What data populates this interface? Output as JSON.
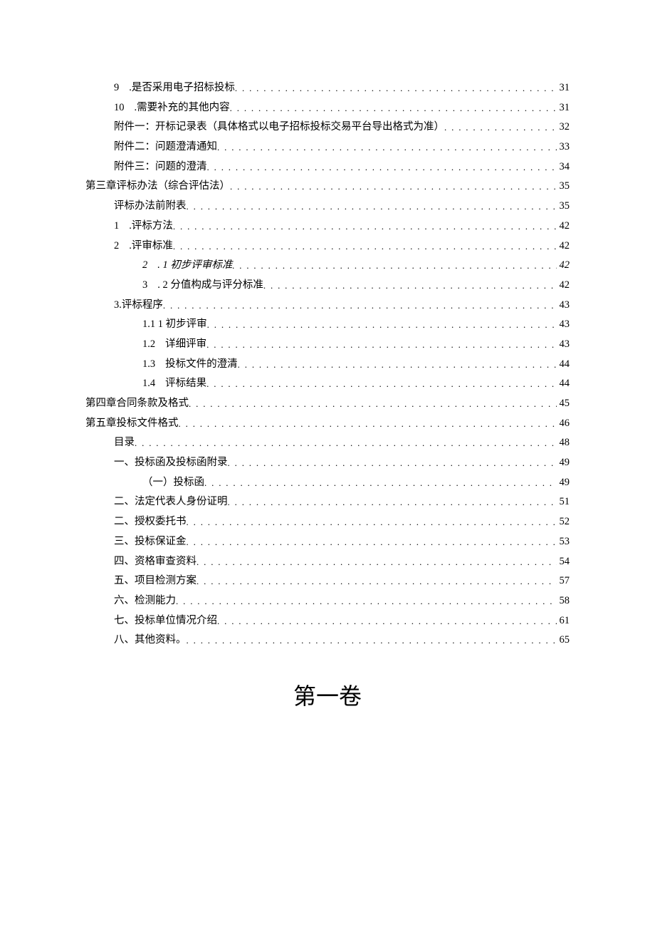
{
  "toc": [
    {
      "indent": 1,
      "num": "9",
      "sep": true,
      "label": ".是否采用电子招标投标",
      "page": "31",
      "italic": false
    },
    {
      "indent": 1,
      "num": "10",
      "sep": true,
      "label": ".需要补充的其他内容",
      "page": "31",
      "italic": false
    },
    {
      "indent": 1,
      "num": "",
      "sep": false,
      "label": "附件一：开标记录表（具体格式以电子招标投标交易平台导出格式为准）",
      "page": "32",
      "italic": false
    },
    {
      "indent": 1,
      "num": "",
      "sep": false,
      "label": "附件二：问题澄清通知",
      "page": "33",
      "italic": false
    },
    {
      "indent": 1,
      "num": "",
      "sep": false,
      "label": "附件三：问题的澄清",
      "page": "34",
      "italic": false
    },
    {
      "indent": 0,
      "num": "",
      "sep": false,
      "label": "第三章评标办法（综合评估法）",
      "page": "35",
      "italic": false
    },
    {
      "indent": 1,
      "num": "",
      "sep": false,
      "label": "评标办法前附表",
      "page": "35",
      "italic": false
    },
    {
      "indent": 1,
      "num": "1",
      "sep": true,
      "label": ".评标方法",
      "page": "42",
      "italic": false
    },
    {
      "indent": 1,
      "num": "2",
      "sep": true,
      "label": ".评审标准",
      "page": "42",
      "italic": false
    },
    {
      "indent": 2,
      "num": "2",
      "sep": true,
      "label": ". 1 初步评审标准",
      "page": "42",
      "italic": true
    },
    {
      "indent": 2,
      "num": "3",
      "sep": true,
      "label": ". 2 分值构成与评分标准",
      "page": "42",
      "italic": false
    },
    {
      "indent": 1,
      "num": "",
      "sep": false,
      "label": "3.评标程序",
      "page": "43",
      "italic": false
    },
    {
      "indent": 2,
      "num": "",
      "sep": false,
      "label": "1.1 1 初步评审",
      "page": "43",
      "italic": false
    },
    {
      "indent": 2,
      "num": "1.2",
      "sep": true,
      "label": "详细评审",
      "page": "43",
      "italic": false
    },
    {
      "indent": 2,
      "num": "1.3",
      "sep": true,
      "label": "投标文件的澄清",
      "page": "44",
      "italic": false
    },
    {
      "indent": 2,
      "num": "1.4",
      "sep": true,
      "label": "评标结果",
      "page": "44",
      "italic": false
    },
    {
      "indent": 0,
      "num": "",
      "sep": false,
      "label": "第四章合同条款及格式",
      "page": "45",
      "italic": false
    },
    {
      "indent": 0,
      "num": "",
      "sep": false,
      "label": "第五章投标文件格式",
      "page": "46",
      "italic": false
    },
    {
      "indent": 1,
      "num": "",
      "sep": false,
      "label": "目录",
      "page": "48",
      "italic": false
    },
    {
      "indent": 1,
      "num": "",
      "sep": false,
      "label": "一、投标函及投标函附录",
      "page": "49",
      "italic": false
    },
    {
      "indent": 2,
      "num": "",
      "sep": false,
      "label": "（一）投标函",
      "page": "49",
      "italic": false
    },
    {
      "indent": 1,
      "num": "",
      "sep": false,
      "label": "二、法定代表人身份证明",
      "page": "51",
      "italic": false
    },
    {
      "indent": 1,
      "num": "",
      "sep": false,
      "label": "二、授权委托书",
      "page": "52",
      "italic": false
    },
    {
      "indent": 1,
      "num": "",
      "sep": false,
      "label": "三、投标保证金",
      "page": "53",
      "italic": false
    },
    {
      "indent": 1,
      "num": "",
      "sep": false,
      "label": "四、资格审查资料",
      "page": "54",
      "italic": false
    },
    {
      "indent": 1,
      "num": "",
      "sep": false,
      "label": "五、项目检测方案",
      "page": "57",
      "italic": false
    },
    {
      "indent": 1,
      "num": "",
      "sep": false,
      "label": "六、检测能力",
      "page": "58",
      "italic": false
    },
    {
      "indent": 1,
      "num": "",
      "sep": false,
      "label": "七、投标单位情况介绍",
      "page": "61",
      "italic": false
    },
    {
      "indent": 1,
      "num": "",
      "sep": false,
      "label": "八、其他资料。",
      "page": "65",
      "italic": false
    }
  ],
  "volume_heading": "第一卷"
}
